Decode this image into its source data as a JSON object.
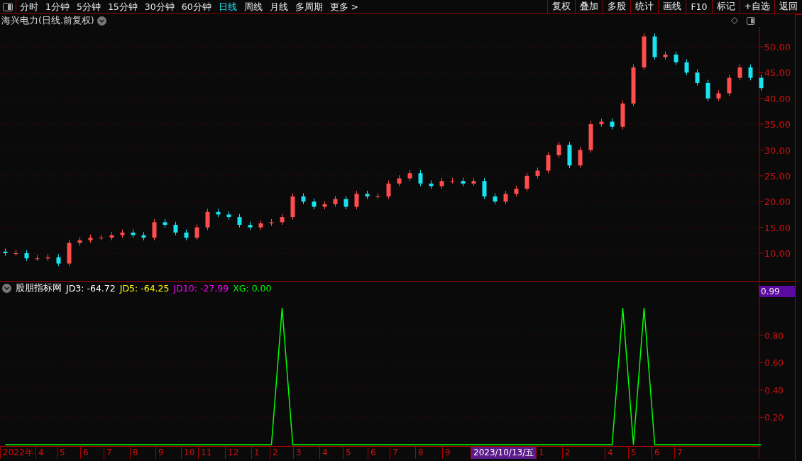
{
  "toolbar": {
    "periods": [
      {
        "label": "分时",
        "selected": false
      },
      {
        "label": "1分钟",
        "selected": false
      },
      {
        "label": "5分钟",
        "selected": false
      },
      {
        "label": "15分钟",
        "selected": false
      },
      {
        "label": "30分钟",
        "selected": false
      },
      {
        "label": "60分钟",
        "selected": false
      },
      {
        "label": "日线",
        "selected": true
      },
      {
        "label": "周线",
        "selected": false
      },
      {
        "label": "月线",
        "selected": false
      },
      {
        "label": "多周期",
        "selected": false
      },
      {
        "label": "更多 >",
        "selected": false
      }
    ],
    "buttons": [
      "复权",
      "叠加",
      "多股",
      "统计",
      "画线",
      "F10",
      "标记",
      "+自选",
      "返回"
    ]
  },
  "price_panel": {
    "title": "海兴电力(日线.前复权)",
    "chart_data": {
      "type": "candlestick",
      "grid": true,
      "ylim": [
        4.64,
        53.85
      ],
      "yticks": [
        {
          "value": 10,
          "label": "10.00"
        },
        {
          "value": 15,
          "label": "15.00"
        },
        {
          "value": 20,
          "label": "20.00"
        },
        {
          "value": 25,
          "label": "25.00"
        },
        {
          "value": 30,
          "label": "30.00"
        },
        {
          "value": 35,
          "label": "35.00"
        },
        {
          "value": 40,
          "label": "40.00"
        },
        {
          "value": 45,
          "label": "45.00"
        },
        {
          "value": 50,
          "label": "50.00"
        }
      ],
      "ohlc": [
        [
          10.3,
          10.9,
          9.5,
          10
        ],
        [
          10,
          10.6,
          9.5,
          10
        ],
        [
          10,
          10.6,
          8.5,
          9
        ],
        [
          9,
          9.6,
          8.5,
          9
        ],
        [
          9,
          9.8,
          8.5,
          9.2
        ],
        [
          9.2,
          9.8,
          7.5,
          8
        ],
        [
          8,
          12.6,
          7.5,
          12
        ],
        [
          12,
          13.1,
          11.5,
          12.5
        ],
        [
          12.5,
          13.6,
          12,
          13
        ],
        [
          13,
          13.6,
          12.5,
          13
        ],
        [
          13,
          14.1,
          12.5,
          13.5
        ],
        [
          13.5,
          14.6,
          13,
          14
        ],
        [
          14,
          14.6,
          13,
          13.5
        ],
        [
          13.5,
          14.1,
          12.5,
          13
        ],
        [
          13,
          16.6,
          12.5,
          16
        ],
        [
          16,
          16.6,
          15,
          15.5
        ],
        [
          15.5,
          16.1,
          13.5,
          14
        ],
        [
          14,
          14.6,
          12.5,
          13
        ],
        [
          13,
          15.6,
          12.5,
          15
        ],
        [
          15,
          18.6,
          14.5,
          18
        ],
        [
          18,
          18.6,
          17,
          17.5
        ],
        [
          17.5,
          18.1,
          16.5,
          17
        ],
        [
          17,
          17.6,
          15,
          15.5
        ],
        [
          15.5,
          16.1,
          14.5,
          15
        ],
        [
          15,
          16.4,
          14.5,
          15.8
        ],
        [
          15.8,
          16.6,
          15.3,
          16
        ],
        [
          16,
          17.6,
          15.5,
          17
        ],
        [
          17,
          21.6,
          16.5,
          21
        ],
        [
          21,
          21.6,
          19.5,
          20
        ],
        [
          20,
          20.6,
          18.5,
          19
        ],
        [
          19,
          20.1,
          18.5,
          19.5
        ],
        [
          19.5,
          21.1,
          19,
          20.5
        ],
        [
          20.5,
          21.1,
          18.5,
          19
        ],
        [
          19,
          22.1,
          18.5,
          21.5
        ],
        [
          21.5,
          22.1,
          20.5,
          21
        ],
        [
          21,
          21.6,
          20.5,
          21
        ],
        [
          21,
          24.1,
          20.5,
          23.5
        ],
        [
          23.5,
          25.1,
          23,
          24.5
        ],
        [
          24.5,
          26.1,
          24,
          25.5
        ],
        [
          25.5,
          26.1,
          23,
          23.5
        ],
        [
          23.5,
          24.1,
          22.5,
          23
        ],
        [
          23,
          24.6,
          22.5,
          24
        ],
        [
          24,
          24.6,
          23.5,
          24
        ],
        [
          24,
          24.6,
          23,
          23.5
        ],
        [
          23.5,
          24.6,
          23,
          24
        ],
        [
          24,
          24.6,
          20.5,
          21
        ],
        [
          21,
          21.6,
          19.5,
          20
        ],
        [
          20,
          22.1,
          19.5,
          21.5
        ],
        [
          21.5,
          23.1,
          21,
          22.5
        ],
        [
          22.5,
          25.6,
          22,
          25
        ],
        [
          25,
          26.6,
          24.5,
          26
        ],
        [
          26,
          29.6,
          25.5,
          29
        ],
        [
          29,
          31.6,
          28.5,
          31
        ],
        [
          31,
          31.6,
          26.5,
          27
        ],
        [
          27,
          30.6,
          26.5,
          30
        ],
        [
          30,
          35.6,
          29.5,
          35
        ],
        [
          35,
          36.1,
          34.5,
          35.5
        ],
        [
          35.5,
          36.1,
          34,
          34.5
        ],
        [
          34.5,
          39.6,
          34,
          39
        ],
        [
          39,
          46.6,
          38.5,
          46
        ],
        [
          46,
          52.6,
          45.5,
          52
        ],
        [
          52,
          52.6,
          47.5,
          48
        ],
        [
          48,
          49.1,
          47.5,
          48.5
        ],
        [
          48.5,
          49.1,
          46.5,
          47
        ],
        [
          47,
          47.6,
          44.5,
          45
        ],
        [
          45,
          45.6,
          42.5,
          43
        ],
        [
          43,
          43.6,
          39.5,
          40
        ],
        [
          40,
          41.6,
          39.5,
          41
        ],
        [
          41,
          44.6,
          40.5,
          44
        ],
        [
          44,
          46.6,
          43.5,
          46
        ],
        [
          46,
          46.6,
          43.5,
          44
        ],
        [
          44,
          44.6,
          41.5,
          42
        ]
      ]
    }
  },
  "indicator_panel": {
    "name": "股朋指标网",
    "readings": [
      {
        "label": "JD3: -64.72",
        "color": "#ffffff"
      },
      {
        "label": "JD5: -64.25",
        "color": "#ffff00"
      },
      {
        "label": "JD10: -27.99",
        "color": "#ff00ff"
      },
      {
        "label": "XG: 0.00",
        "color": "#00ff00"
      }
    ],
    "cursor_value": "0.99",
    "chart_data": {
      "type": "line",
      "grid": true,
      "ylim": [
        0,
        1.1
      ],
      "yticks": [
        {
          "value": 0.2,
          "label": "0.20"
        },
        {
          "value": 0.4,
          "label": "0.40"
        },
        {
          "value": 0.6,
          "label": "0.60"
        },
        {
          "value": 0.8,
          "label": "0.80"
        }
      ],
      "series": [
        {
          "color": "#00ff00",
          "values": [
            0,
            0,
            0,
            0,
            0,
            0,
            0,
            0,
            0,
            0,
            0,
            0,
            0,
            0,
            0,
            0,
            0,
            0,
            0,
            0,
            0,
            0,
            0,
            0,
            0,
            0,
            1,
            0,
            0,
            0,
            0,
            0,
            0,
            0,
            0,
            0,
            0,
            0,
            0,
            0,
            0,
            0,
            0,
            0,
            0,
            0,
            0,
            0,
            0,
            0,
            0,
            0,
            0,
            0,
            0,
            0,
            0,
            0,
            1,
            0,
            1,
            0,
            0,
            0,
            0,
            0,
            0,
            0,
            0,
            0,
            0,
            0
          ]
        }
      ]
    }
  },
  "date_axis": [
    {
      "label": "2022年",
      "selected": false
    },
    {
      "label": "4",
      "selected": false
    },
    {
      "label": "5",
      "selected": false
    },
    {
      "label": "6",
      "selected": false
    },
    {
      "label": "7",
      "selected": false
    },
    {
      "label": "8",
      "selected": false
    },
    {
      "label": "9",
      "selected": false
    },
    {
      "label": "10",
      "selected": false
    },
    {
      "label": "11",
      "selected": false
    },
    {
      "label": "12",
      "selected": false
    },
    {
      "label": "1",
      "selected": false
    },
    {
      "label": "2",
      "selected": false
    },
    {
      "label": "3",
      "selected": false
    },
    {
      "label": "4",
      "selected": false
    },
    {
      "label": "5",
      "selected": false
    },
    {
      "label": "6",
      "selected": false
    },
    {
      "label": "7",
      "selected": false
    },
    {
      "label": "8",
      "selected": false
    },
    {
      "label": "9",
      "selected": false
    },
    {
      "label": "2023/10/13/五",
      "selected": true
    },
    {
      "label": "1",
      "selected": false
    },
    {
      "label": "2",
      "selected": false
    },
    {
      "label": "4",
      "selected": false
    },
    {
      "label": "5",
      "selected": false
    },
    {
      "label": "6",
      "selected": false
    },
    {
      "label": "7",
      "selected": false
    }
  ]
}
